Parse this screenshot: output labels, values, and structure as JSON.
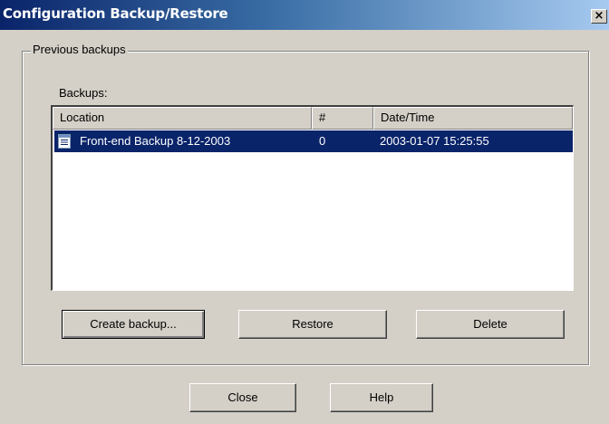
{
  "window": {
    "title": "Configuration Backup/Restore",
    "close_glyph": "×"
  },
  "group": {
    "legend": "Previous backups",
    "list_label": "Backups:",
    "columns": [
      "Location",
      "#",
      "Date/Time"
    ],
    "rows": [
      {
        "icon": "document-icon",
        "location": "Front-end Backup 8-12-2003",
        "number": "0",
        "datetime": "2003-01-07 15:25:55",
        "selected": true
      }
    ],
    "buttons": {
      "create": "Create backup...",
      "restore": "Restore",
      "delete": "Delete"
    }
  },
  "footer": {
    "close": "Close",
    "help": "Help"
  },
  "colors": {
    "selection": "#0a246a",
    "title_start": "#0a246a",
    "title_end": "#a6caf0",
    "face": "#d4d0c8"
  }
}
